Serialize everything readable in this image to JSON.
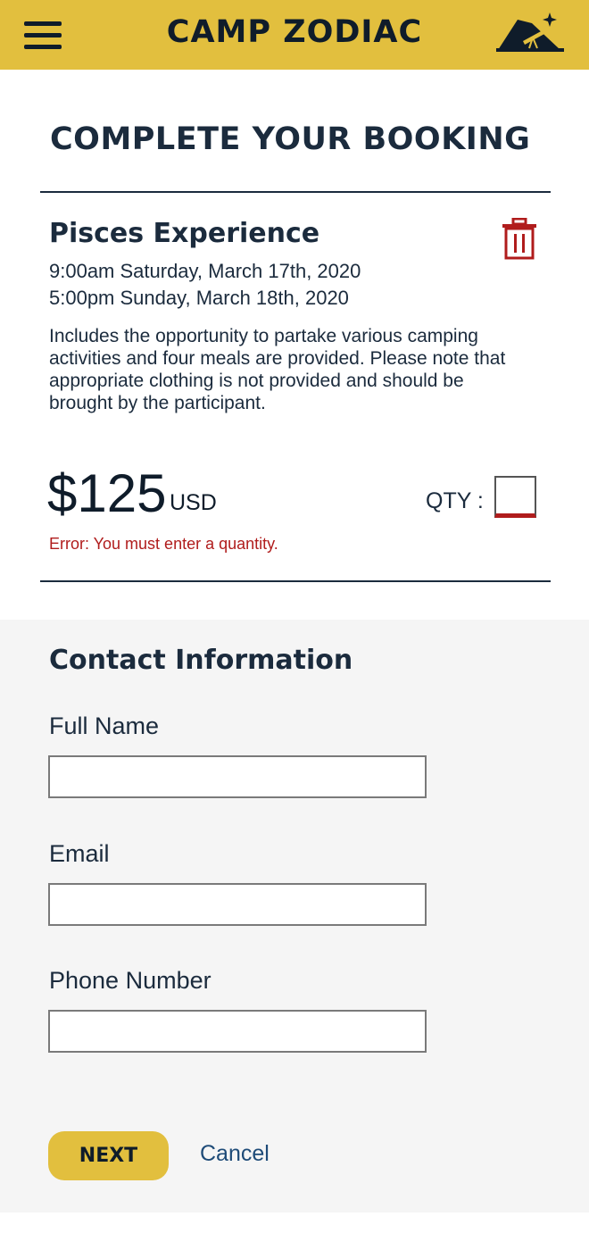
{
  "header": {
    "brand": "CAMP ZODIAC",
    "brand_color": "#e2bf3e",
    "menu_icon": "hamburger-menu-icon",
    "logo_icon": "tent-telescope-icon"
  },
  "page_title": "COMPLETE YOUR BOOKING",
  "booking": {
    "title": "Pisces Experience",
    "start": "9:00am Saturday, March 17th, 2020",
    "end": "5:00pm Sunday, March 18th, 2020",
    "description": "Includes the opportunity to partake various camping activities and four meals are provided. Please note that appropriate clothing is not provided and should be brought by the participant.",
    "price": "$125",
    "currency": "USD",
    "qty_label": "QTY :",
    "qty_value": "",
    "error": "Error: You must enter a quantity.",
    "error_color": "#b01c1c",
    "delete_icon": "trash-icon"
  },
  "contact": {
    "title": "Contact Information",
    "full_name_label": "Full Name",
    "full_name_value": "",
    "email_label": "Email",
    "email_value": "",
    "phone_label": "Phone Number",
    "phone_value": ""
  },
  "actions": {
    "next_label": "NEXT",
    "cancel_label": "Cancel"
  }
}
